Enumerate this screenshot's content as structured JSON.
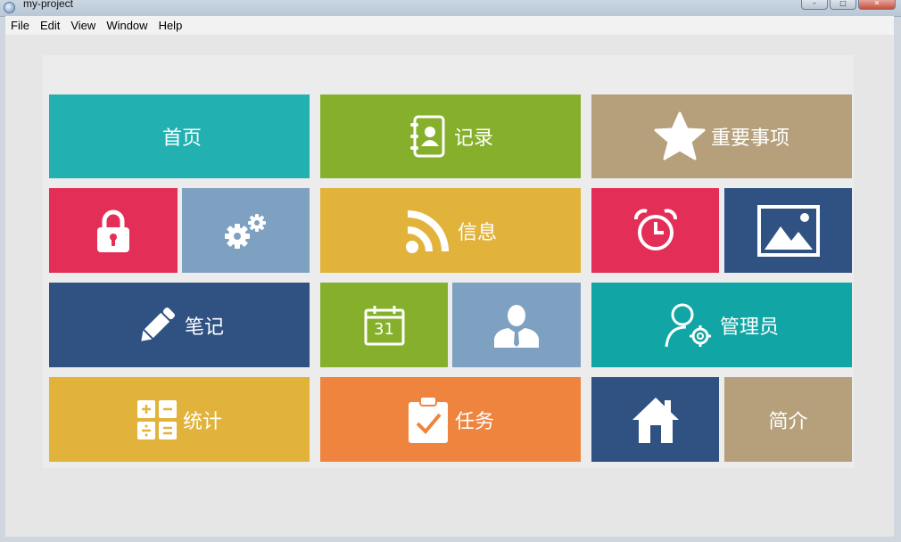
{
  "window": {
    "title": "my-project"
  },
  "menu": [
    {
      "label": "File"
    },
    {
      "label": "Edit"
    },
    {
      "label": "View"
    },
    {
      "label": "Window"
    },
    {
      "label": "Help"
    }
  ],
  "tiles": [
    {
      "name": "tile-home",
      "label": "首页",
      "color": "#22b0b0",
      "icon": ""
    },
    {
      "name": "tile-records",
      "label": "记录",
      "color": "#86b02b",
      "icon": "address-book-icon"
    },
    {
      "name": "tile-important",
      "label": "重要事项",
      "color": "#b5a07b",
      "icon": "star-icon"
    },
    {
      "name": "tile-lock",
      "label": "",
      "color": "#e32e57",
      "icon": "lock-icon"
    },
    {
      "name": "tile-settings",
      "label": "",
      "color": "#7fa1c1",
      "icon": "gears-icon"
    },
    {
      "name": "tile-info",
      "label": "信息",
      "color": "#e2b33b",
      "icon": "rss-icon"
    },
    {
      "name": "tile-alarm",
      "label": "",
      "color": "#e32e57",
      "icon": "alarm-clock-icon"
    },
    {
      "name": "tile-gallery",
      "label": "",
      "color": "#2f5283",
      "icon": "picture-icon"
    },
    {
      "name": "tile-notes",
      "label": "笔记",
      "color": "#2f5283",
      "icon": "pencil-icon"
    },
    {
      "name": "tile-calendar",
      "label": "31",
      "color": "#86b02b",
      "icon": "calendar-icon"
    },
    {
      "name": "tile-user",
      "label": "",
      "color": "#7fa1c1",
      "icon": "user-icon"
    },
    {
      "name": "tile-admin",
      "label": "管理员",
      "color": "#11a5a5",
      "icon": "user-settings-icon"
    },
    {
      "name": "tile-stats",
      "label": "统计",
      "color": "#e2b33b",
      "icon": "calculator-icon"
    },
    {
      "name": "tile-tasks",
      "label": "任务",
      "color": "#ee843e",
      "icon": "clipboard-check-icon"
    },
    {
      "name": "tile-house",
      "label": "",
      "color": "#2f5283",
      "icon": "house-icon"
    },
    {
      "name": "tile-about",
      "label": "简介",
      "color": "#b5a07b",
      "icon": ""
    }
  ]
}
